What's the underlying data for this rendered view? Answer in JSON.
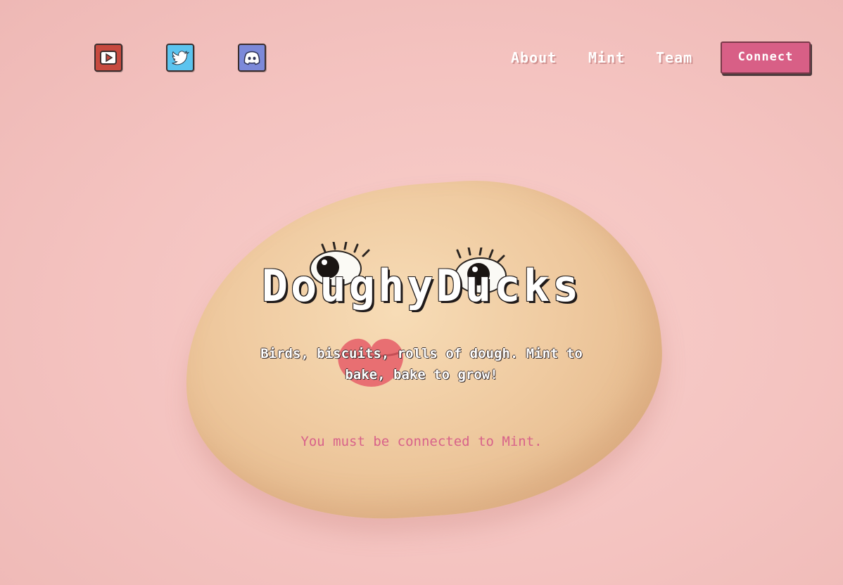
{
  "header": {
    "social": [
      {
        "name": "youtube",
        "icon": "youtube-icon",
        "color": "#c74a3f"
      },
      {
        "name": "twitter",
        "icon": "twitter-icon",
        "color": "#5cc4ef"
      },
      {
        "name": "discord",
        "icon": "discord-icon",
        "color": "#7c89d9"
      }
    ],
    "nav": {
      "about": "About",
      "mint": "Mint",
      "team": "Team"
    },
    "connect_label": "Connect"
  },
  "hero": {
    "title": "DoughyDucks",
    "subtitle": "Birds, biscuits, rolls of dough. Mint to bake, bake to grow!",
    "notice": "You must be connected to Mint."
  },
  "colors": {
    "background": "#f4c3c0",
    "accent": "#d85f86",
    "notice_text": "#d8628a"
  }
}
